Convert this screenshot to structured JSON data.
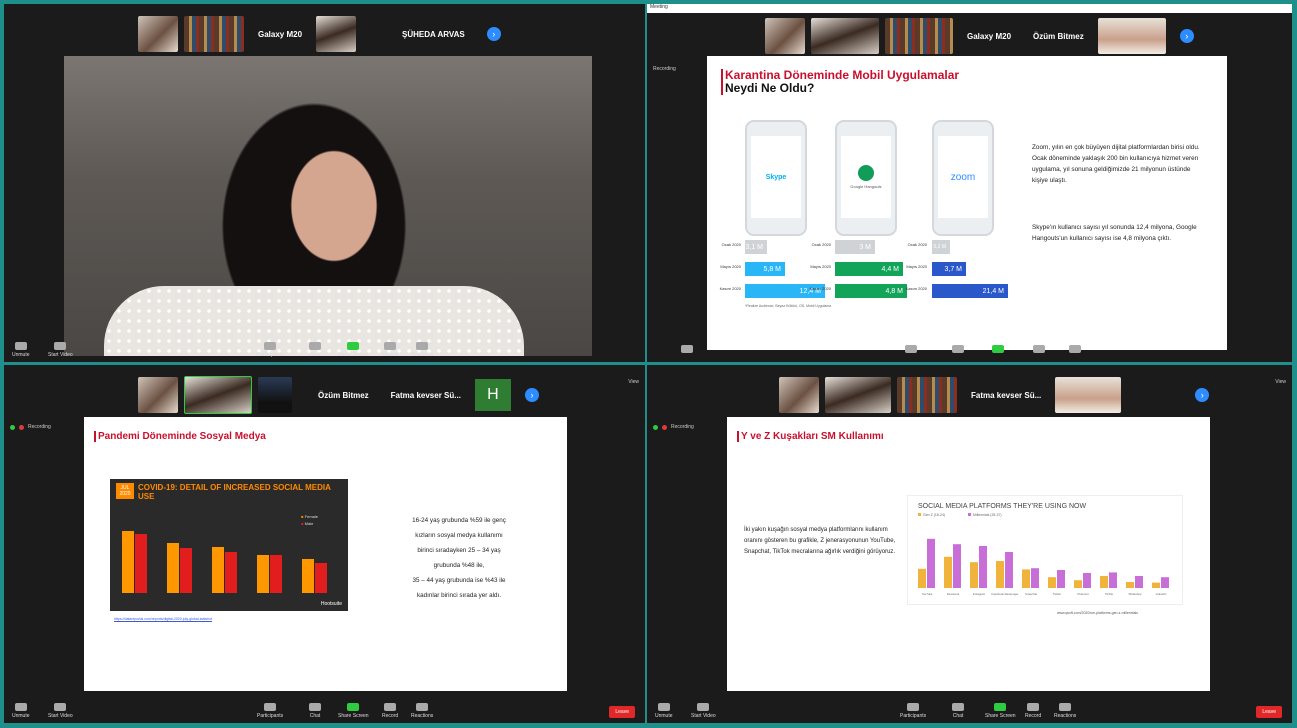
{
  "window_title": "Meeting",
  "q1": {
    "strip_names": [
      "Galaxy M20",
      "ŞÜHEDA ARVAS"
    ]
  },
  "q2": {
    "strip_names": [
      "Galaxy M20",
      "Özüm Bitmez"
    ],
    "recording": "Recording",
    "slide_title_1": "Karantina Döneminde Mobil Uygulamalar",
    "slide_title_2": "Neydi Ne Oldu?",
    "apps": [
      "Skype",
      "Google Hangouts",
      "zoom"
    ],
    "row_labels": [
      "Ocak 2020",
      "Mayıs 2020",
      "Kasım 2020"
    ],
    "skype_values": [
      "3,1 M",
      "5,8 M",
      "12,4 M"
    ],
    "hangouts_values": [
      "3 M",
      "4,4 M",
      "4,8 M"
    ],
    "zoom_values": [
      "0,2 M",
      "3,7 M",
      "21,4 M"
    ],
    "source_note": "*Realize Audience, Beyaz Kültürü, OS, Mobil Uygulama",
    "para1": "Zoom, yılın en çok büyüyen dijital platformlardan birisi oldu. Ocak döneminde yaklaşık 200 bin kullanıcıya hizmet veren uygulama, yıl sonuna geldiğimizde 21 milyonun üstünde kişiye ulaştı.",
    "para2": "Skype'ın kullanıcı sayısı yıl sonunda 12,4 milyona, Google Hangouts'un kullanıcı sayısı ise 4,8 milyona çıktı."
  },
  "q3": {
    "strip_names": [
      "Özüm Bitmez",
      "Fatma kevser Sü..."
    ],
    "h_initial": "H",
    "view_label": "View",
    "recording": "Recording",
    "slide_title": "Pandemi Döneminde Sosyal Medya",
    "info_date": "JUL 2020",
    "info_title": "COVID-19: DETAIL OF INCREASED SOCIAL MEDIA USE",
    "info_legend": [
      "Female",
      "Male"
    ],
    "info_brand": "Hootsuite",
    "bars_female": [
      78,
      63,
      58,
      47,
      42
    ],
    "bars_male": [
      74,
      56,
      51,
      47,
      38
    ],
    "link_text": "https://datareportal.com/reports/digital-2020-july-global-statshot",
    "line1": "16-24 yaş grubunda %59 ile genç",
    "line2": "kızların sosyal medya kullanımı",
    "line3": "birinci sıradayken 25 – 34 yaş",
    "line4": "grubunda %48 ile,",
    "line5": "35 – 44 yaş grubunda ise %43 ile",
    "line6": "kadınlar birinci sırada yer aldı."
  },
  "q4": {
    "strip_names": [
      "Fatma kevser Sü..."
    ],
    "view_label": "View",
    "recording": "Recording",
    "slide_title": "Y ve Z Kuşakları SM Kullanımı",
    "chart_title": "SOCIAL MEDIA PLATFORMS THEY'RE USING NOW",
    "legend": [
      "Gen Z (18-24)",
      "Millennials (25-37)"
    ],
    "text": "İki yakın kuşağın sosyal medya platformlarını kullanım oranını gösteren bu grafikle, Z jenerasyonunun YouTube, Snapchat, TikTok mecralarına ağırlık verdiğini görüyoruz.",
    "footer": "www.qsoft.com/2020/sm-platforms-gen-z-millennials"
  },
  "toolbar": {
    "unmute": "Unmute",
    "start_video": "Start Video",
    "participants": "Participants",
    "chat": "Chat",
    "share": "Share Screen",
    "record": "Record",
    "reactions": "Reactions",
    "leave": "Leave"
  },
  "chart_data": {
    "type": "bar",
    "categories": [
      "YouTube",
      "Facebook",
      "Instagram",
      "Facebook Messenger",
      "Snapchat",
      "Twitter",
      "Pinterest",
      "TikTok",
      "WhatsApp",
      "LinkedIn"
    ],
    "series": [
      {
        "name": "Gen Z (18-24)",
        "values": [
          32,
          52,
          43,
          45,
          31,
          18,
          13,
          20,
          10,
          9
        ]
      },
      {
        "name": "Millennials (25-37)",
        "values": [
          82,
          73,
          70,
          60,
          33,
          30,
          25,
          26,
          20,
          18
        ]
      }
    ],
    "title": "SOCIAL MEDIA PLATFORMS THEY'RE USING NOW"
  }
}
